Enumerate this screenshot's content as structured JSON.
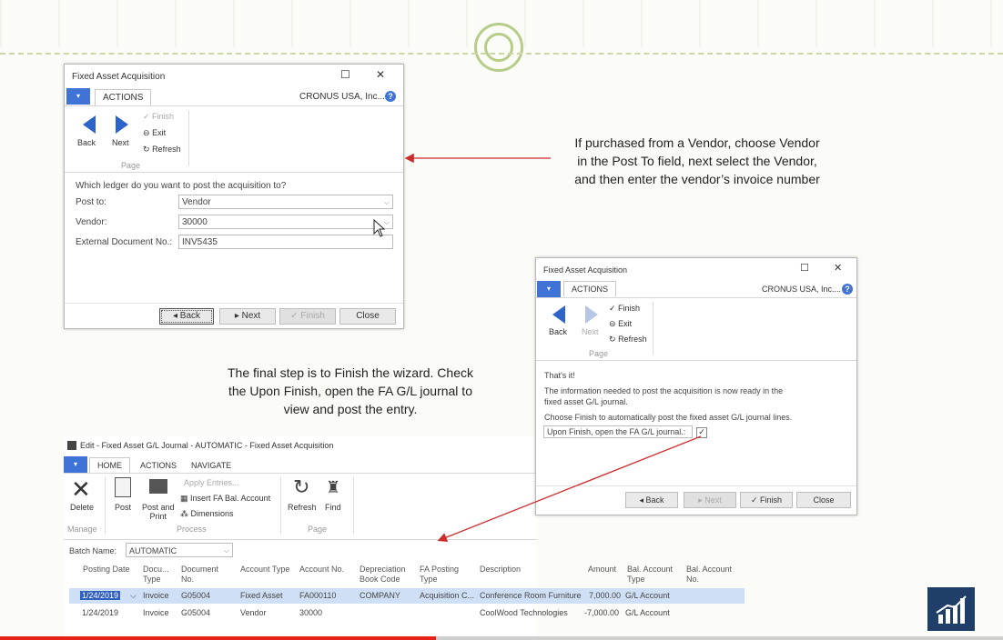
{
  "dialog1": {
    "title": "Fixed Asset Acquisition",
    "menu_icon": "menu-icon",
    "tab_actions": "ACTIONS",
    "company": "CRONUS USA, Inc....",
    "back_label": "Back",
    "next_label": "Next",
    "finish_label": "Finish",
    "exit_label": "Exit",
    "refresh_label": "Refresh",
    "group_page": "Page",
    "question": "Which ledger do you want to post the acquisition to?",
    "post_to_label": "Post to:",
    "post_to_value": "Vendor",
    "vendor_label": "Vendor:",
    "vendor_value": "30000",
    "ext_doc_label": "External Document No.:",
    "ext_doc_value": "INV5435",
    "btn_back": "Back",
    "btn_next": "Next",
    "btn_finish": "Finish",
    "btn_close": "Close"
  },
  "dialog2": {
    "title": "Fixed Asset Acquisition",
    "tab_actions": "ACTIONS",
    "company": "CRONUS USA, Inc....",
    "back_label": "Back",
    "next_label": "Next",
    "finish_label": "Finish",
    "exit_label": "Exit",
    "refresh_label": "Refresh",
    "group_page": "Page",
    "thats_it": "That's it!",
    "info_line1": "The information needed to post the acquisition is  now ready in the",
    "info_line2": "fixed asset G/L journal.",
    "choose_line": "Choose Finish to automatically post the fixed asset G/L journal lines.",
    "upon_finish_label": "Upon Finish, open the FA G/L journal.:",
    "upon_finish_checked": "✓",
    "btn_back": "Back",
    "btn_next": "Next",
    "btn_finish": "Finish",
    "btn_close": "Close"
  },
  "notes": {
    "note1_line1": "If purchased from a Vendor, choose Vendor",
    "note1_line2": "in the Post To field, next select the Vendor,",
    "note1_line3": "and then enter the vendor’s invoice number",
    "note2_line1": "The final step is to Finish the wizard.  Check",
    "note2_line2": "the Upon Finish, open the FA G/L journal to",
    "note2_line3": "view and post the entry."
  },
  "journal": {
    "title": "Edit - Fixed Asset G/L Journal - AUTOMATIC - Fixed Asset Acquisition",
    "tab_home": "HOME",
    "tab_actions": "ACTIONS",
    "tab_navigate": "NAVIGATE",
    "delete_label": "Delete",
    "group_manage": "Manage",
    "post_label": "Post",
    "post_print_line1": "Post and",
    "post_print_line2": "Print",
    "apply_entries": "Apply Entries...",
    "insert_bal": "Insert FA Bal. Account",
    "dimensions": "Dimensions",
    "group_process": "Process",
    "refresh_label": "Refresh",
    "find_label": "Find",
    "group_page": "Page",
    "batch_label": "Batch Name:",
    "batch_value": "AUTOMATIC",
    "columns": [
      [
        "Posting Date",
        ""
      ],
      [
        "Docu...",
        "Type"
      ],
      [
        "Document",
        "No."
      ],
      [
        "Account Type",
        ""
      ],
      [
        "Account No.",
        ""
      ],
      [
        "Depreciation",
        "Book Code"
      ],
      [
        "FA Posting",
        "Type"
      ],
      [
        "Description",
        ""
      ],
      [
        "Amount",
        ""
      ],
      [
        "Bal. Account",
        "Type"
      ],
      [
        "Bal. Account",
        "No."
      ]
    ],
    "rows": [
      [
        "1/24/2019",
        "Invoice",
        "G05004",
        "Fixed Asset",
        "FA000110",
        "COMPANY",
        "Acquisition C...",
        "Conference Room Furniture",
        "7,000.00",
        "G/L Account",
        ""
      ],
      [
        "1/24/2019",
        "Invoice",
        "G05004",
        "Vendor",
        "30000",
        "",
        "",
        "CoolWood Technologies",
        "-7,000.00",
        "G/L Account",
        ""
      ]
    ]
  },
  "video": {
    "progress": 0.435
  },
  "colors": {
    "accent": "#3f74d6",
    "annotation_arrow": "#cc2b2b",
    "progress": "#e62117"
  }
}
